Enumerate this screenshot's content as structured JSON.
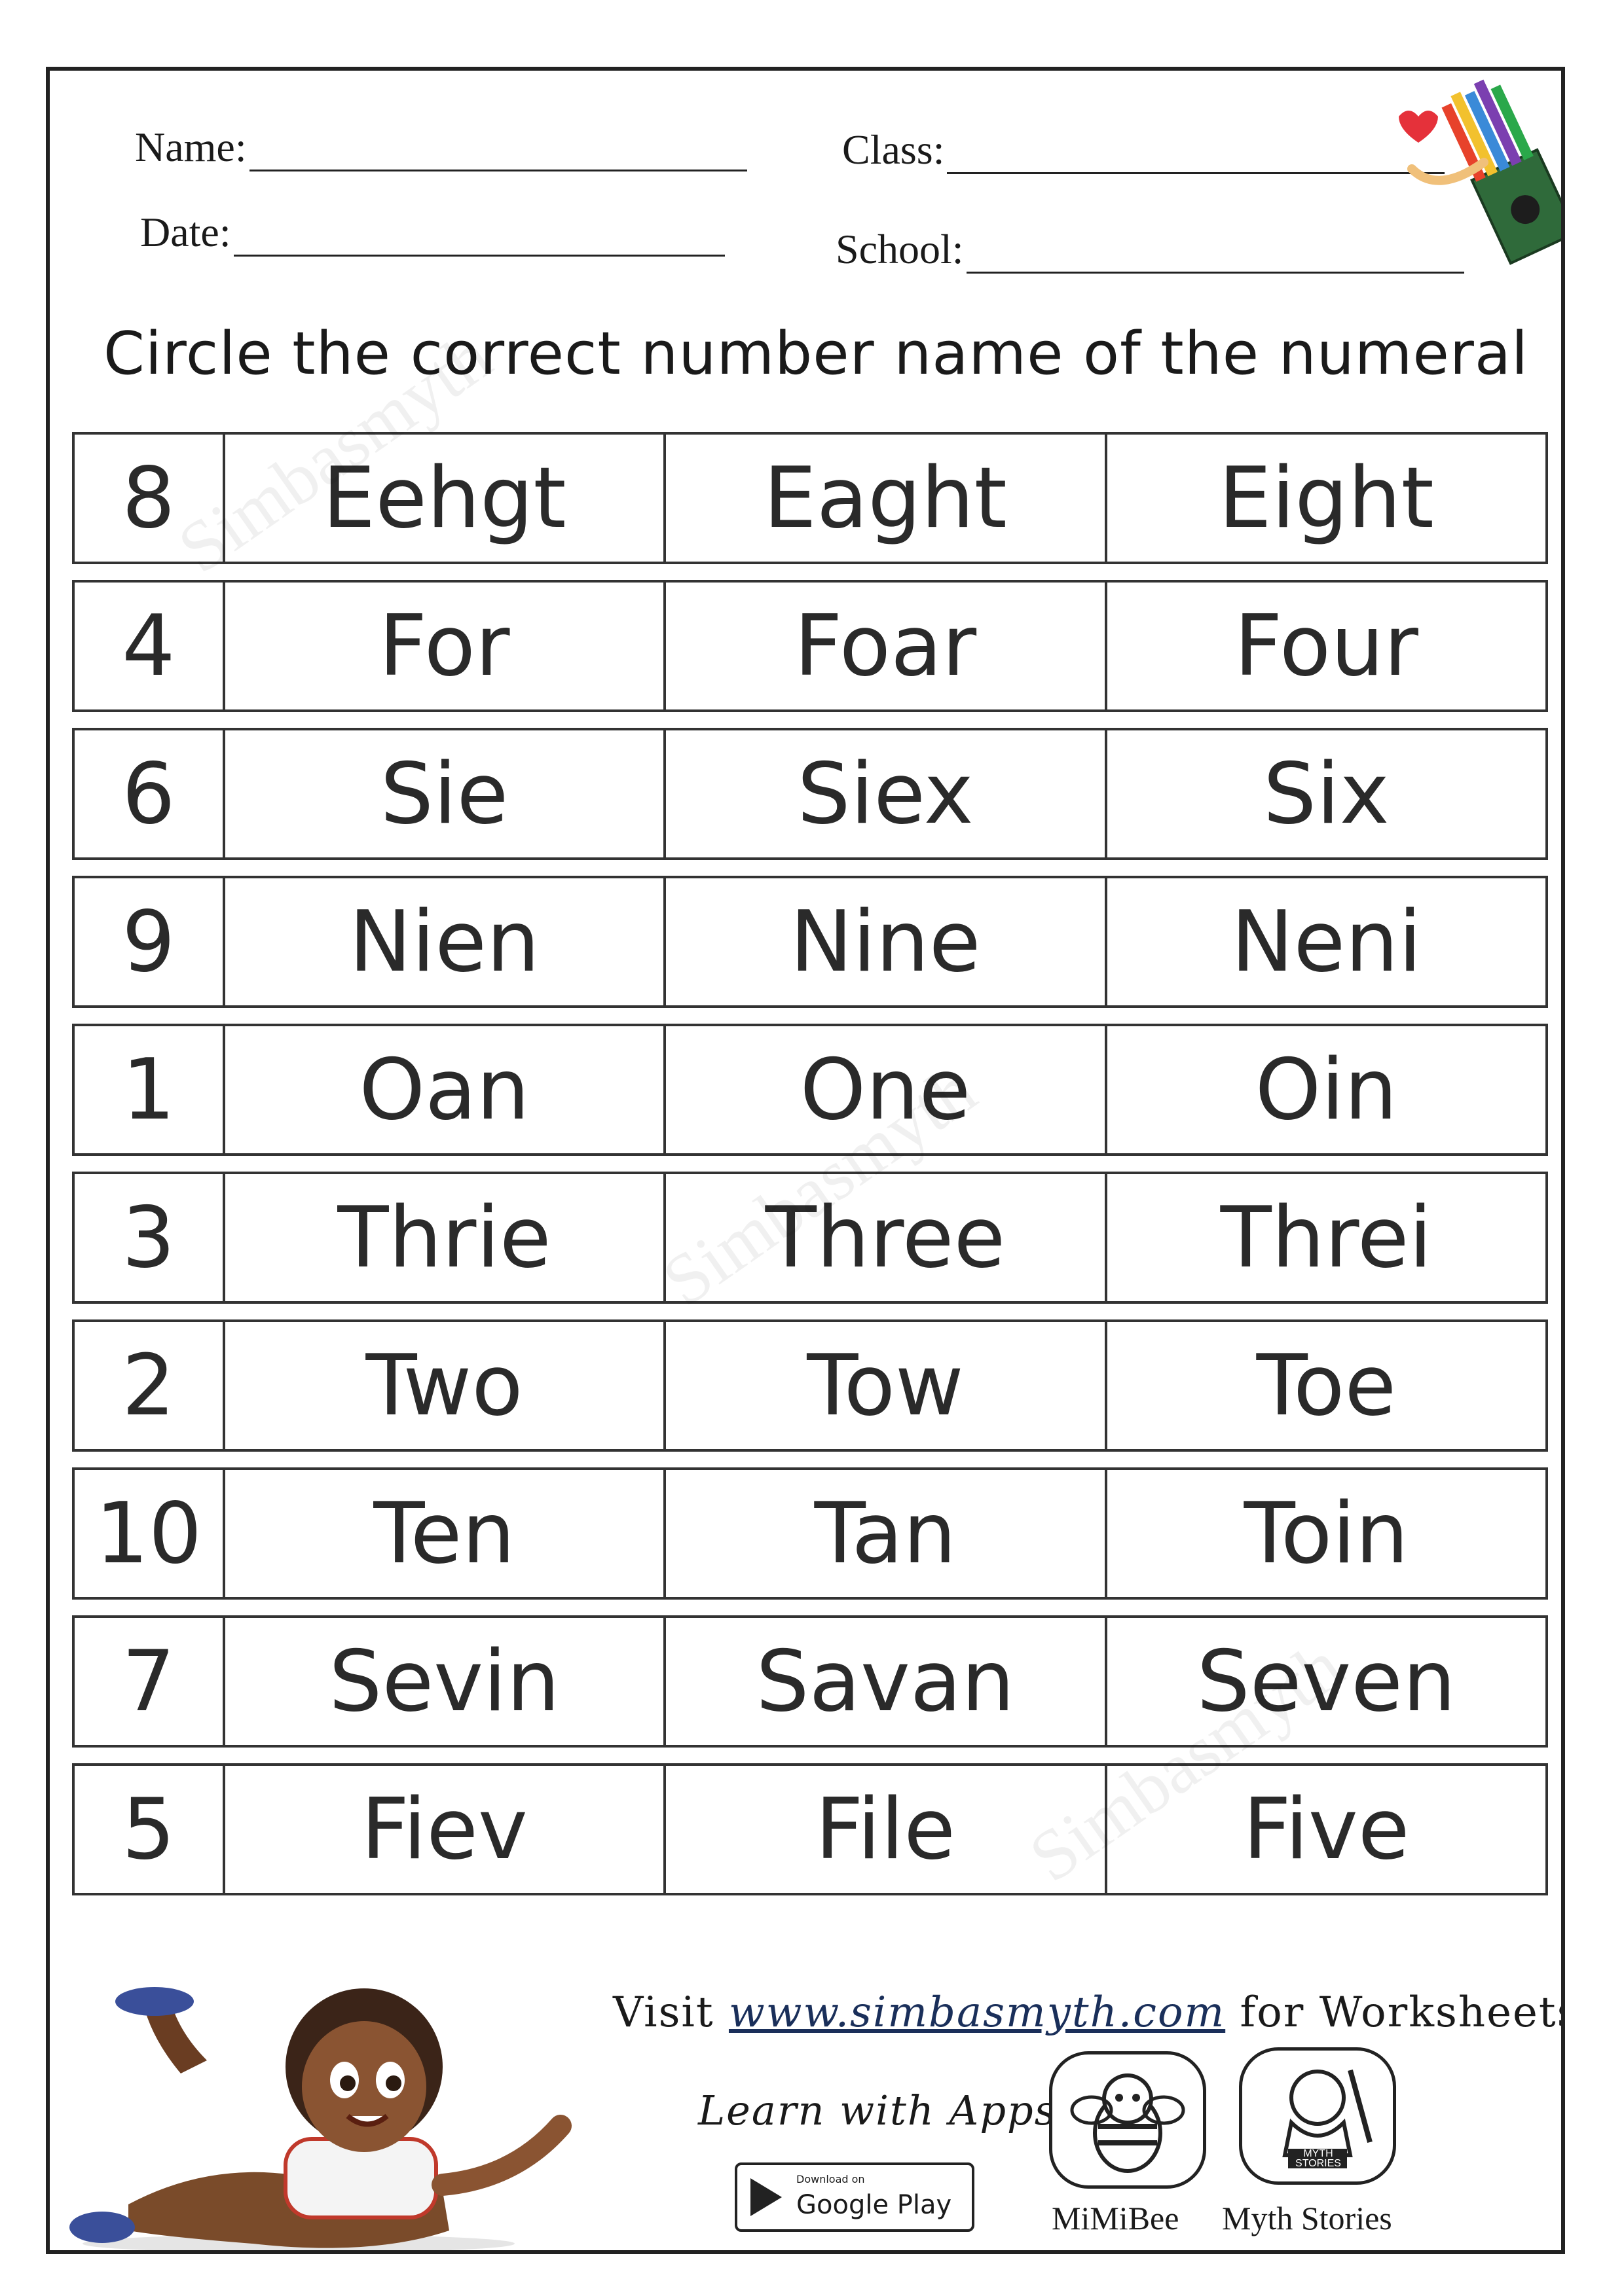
{
  "header": {
    "name_label": "Name:",
    "class_label": "Class:",
    "date_label": "Date:",
    "school_label": "School:"
  },
  "instruction": "Circle the correct number name of the numeral",
  "rows": [
    {
      "numeral": "8",
      "options": [
        "Eehgt",
        "Eaght",
        "Eight"
      ]
    },
    {
      "numeral": "4",
      "options": [
        "For",
        "Foar",
        "Four"
      ]
    },
    {
      "numeral": "6",
      "options": [
        "Sie",
        "Siex",
        "Six"
      ]
    },
    {
      "numeral": "9",
      "options": [
        "Nien",
        "Nine",
        "Neni"
      ]
    },
    {
      "numeral": "1",
      "options": [
        "Oan",
        "One",
        "Oin"
      ]
    },
    {
      "numeral": "3",
      "options": [
        "Thrie",
        "Three",
        "Threi"
      ]
    },
    {
      "numeral": "2",
      "options": [
        "Two",
        "Tow",
        "Toe"
      ]
    },
    {
      "numeral": "10",
      "options": [
        "Ten",
        "Tan",
        "Toin"
      ]
    },
    {
      "numeral": "7",
      "options": [
        "Sevin",
        "Savan",
        "Seven"
      ]
    },
    {
      "numeral": "5",
      "options": [
        "Fiev",
        "File",
        "Five"
      ]
    }
  ],
  "watermark": "Simbasmyth",
  "footer": {
    "visit_prefix": "Visit",
    "url": "www.simbasmyth.com",
    "visit_suffix": "for Worksheets",
    "learn_with_apps": "Learn with Apps",
    "google_play_small": "Download on",
    "google_play_big": "Google Play",
    "app1_label": "MiMiBee",
    "app2_label": "Myth Stories",
    "app2_badge": "MYTH STORIES"
  }
}
